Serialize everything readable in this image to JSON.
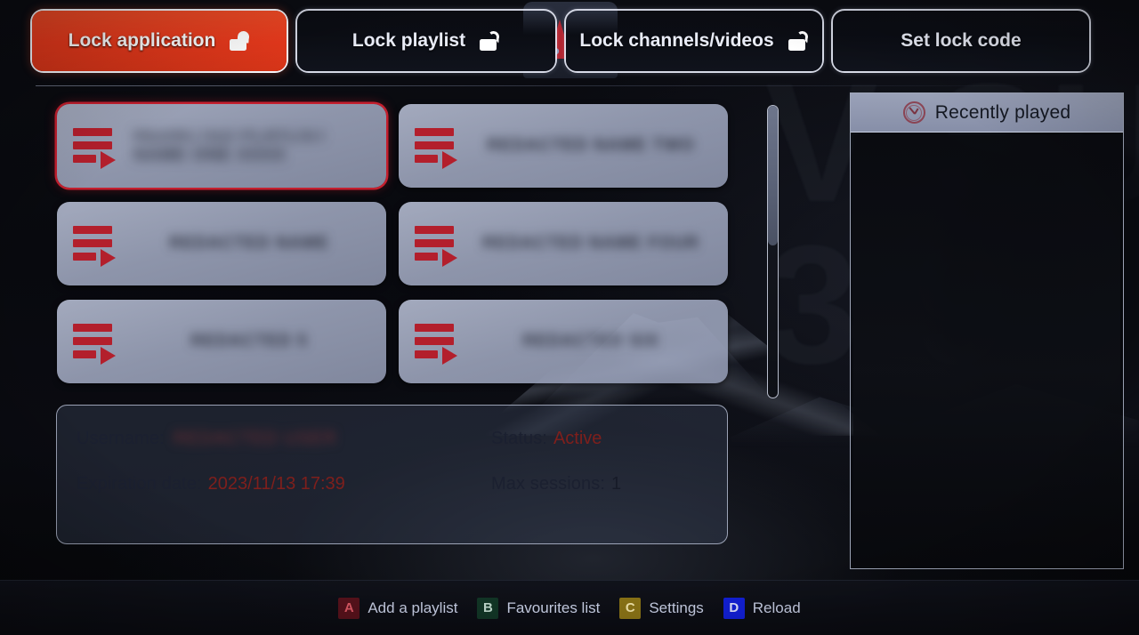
{
  "tabs": [
    {
      "label": "Lock application",
      "icon": "unlock-padlock-icon",
      "selected": true
    },
    {
      "label": "Lock playlist",
      "icon": "unlock-padlock-icon",
      "selected": false
    },
    {
      "label": "Lock channels/videos",
      "icon": "unlock-padlock-icon",
      "selected": false
    },
    {
      "label": "Set lock code",
      "icon": "",
      "selected": false
    }
  ],
  "background": {
    "letters_line1": "V SU",
    "letters_line2": "3 9"
  },
  "logo": {
    "letter": "P"
  },
  "playlists": [
    {
      "name": "REDACTED PLAYLIST NAME ONE XXXX",
      "icon": "playlist-play-icon",
      "selected": true
    },
    {
      "name": "REDACTED NAME TWO",
      "icon": "playlist-play-icon",
      "selected": false
    },
    {
      "name": "REDACTED NAME",
      "icon": "playlist-play-icon",
      "selected": false
    },
    {
      "name": "REDACTED NAME FOUR",
      "icon": "playlist-play-icon",
      "selected": false
    },
    {
      "name": "REDACTED 5",
      "icon": "playlist-play-icon",
      "selected": false
    },
    {
      "name": "REDACTED SIX",
      "icon": "playlist-play-icon",
      "selected": false
    }
  ],
  "scrollbar": {
    "thumb_position_percent": 0,
    "thumb_size_percent": 48
  },
  "recent": {
    "title": "Recently played",
    "icon": "clock-history-icon",
    "items": []
  },
  "account": {
    "username_label": "Username:",
    "username_value": "REDACTED USER",
    "status_label": "Status:",
    "status_value": "Active",
    "expiration_label": "Expiration date:",
    "expiration_value": "2023/11/13 17:39",
    "max_sessions_label": "Max sessions:",
    "max_sessions_value": "1"
  },
  "footer": {
    "hints": [
      {
        "key": "A",
        "label": "Add a playlist",
        "color": "#59121c"
      },
      {
        "key": "B",
        "label": "Favourites list",
        "color": "#123626"
      },
      {
        "key": "C",
        "label": "Settings",
        "color": "#8a7316"
      },
      {
        "key": "D",
        "label": "Reload",
        "color": "#1220d8"
      }
    ]
  },
  "colors": {
    "accent_red": "#e8391c",
    "card_bg": "#a8aec4",
    "status_red": "#7e1f1c",
    "icon_red": "#b31f2c"
  }
}
